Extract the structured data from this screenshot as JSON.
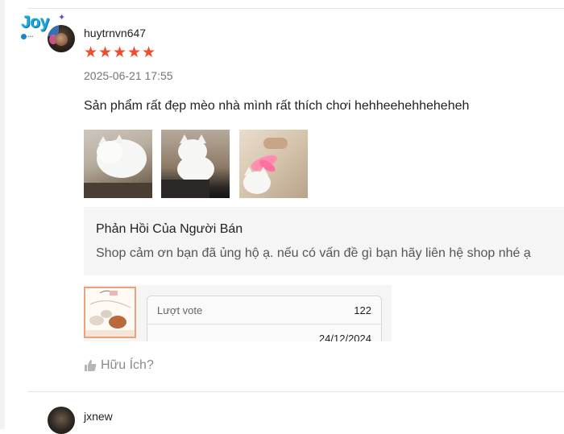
{
  "review": {
    "username": "huytrnvn647",
    "rating": 5,
    "stars": [
      "★",
      "★",
      "★",
      "★",
      "★"
    ],
    "datetime": "2025-06-21 17:55",
    "comment": "Sản phẩm rất đẹp mèo nhà mình rất thích chơi hehheehehheheheh",
    "photos": [
      "review-photo-1",
      "review-photo-2",
      "review-photo-3"
    ],
    "seller_reply": {
      "title": "Phản Hồi Của Người Bán",
      "text": "Shop cảm ơn bạn đã ủng hộ ạ. nếu có vấn đề gì bạn hãy liên hệ shop nhé ạ"
    },
    "product_card": {
      "vote_label": "Lượt vote",
      "vote_count": "122",
      "date": "24/12/2024"
    },
    "helpful_label": "Hữu Ích?"
  },
  "logo": {
    "word": "Joy",
    "sub": "..."
  },
  "next_review": {
    "username": "jxnew"
  },
  "colors": {
    "star": "#ee4d2d",
    "reply_bg": "#f5f5f5",
    "muted": "#757575"
  }
}
